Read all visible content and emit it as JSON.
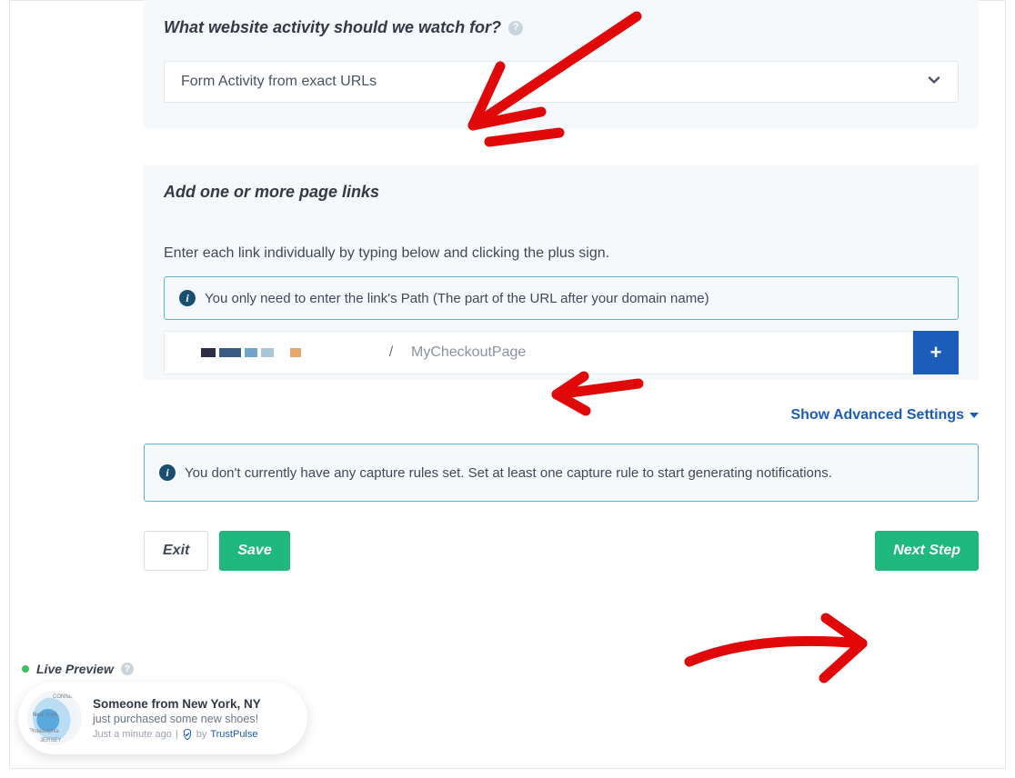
{
  "panel1": {
    "title": "What website activity should we watch for?",
    "select_value": "Form Activity from exact URLs"
  },
  "panel2": {
    "title": "Add one or more page links",
    "instruction": "Enter each link individually by typing below and clicking the plus sign.",
    "info_text": "You only need to enter the link's Path (The part of the URL after your domain name)",
    "path_prefix_separator": "/",
    "path_placeholder": "MyCheckoutPage",
    "add_label": "+"
  },
  "advanced_link": "Show Advanced Settings",
  "warn_text": "You don't currently have any capture rules set. Set at least one capture rule to start generating notifications.",
  "buttons": {
    "exit": "Exit",
    "save": "Save",
    "next": "Next Step"
  },
  "live_preview": {
    "label": "Live Preview",
    "toast_title": "Someone from New York, NY",
    "toast_sub": "just purchased some new shoes!",
    "toast_time": "Just a minute ago",
    "toast_by_prefix": "by ",
    "toast_brand": "TrustPulse",
    "map_labels": {
      "top": "CONNEC",
      "left": "New York",
      "bottom": "JERSEY",
      "city": "Philadelphia"
    }
  }
}
